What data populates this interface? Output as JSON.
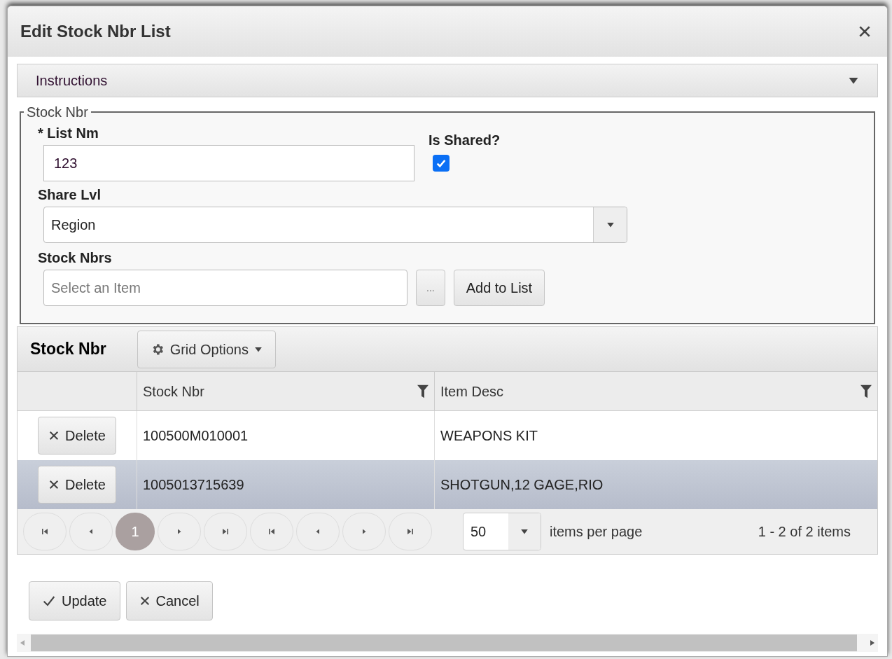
{
  "dialog": {
    "title": "Edit Stock Nbr List"
  },
  "instructions": {
    "label": "Instructions"
  },
  "fieldset": {
    "legend": "Stock Nbr",
    "list_nm": {
      "label": "* List Nm",
      "value": "123"
    },
    "is_shared": {
      "label": "Is Shared?",
      "checked": true
    },
    "share_lvl": {
      "label": "Share Lvl",
      "value": "Region"
    },
    "stock_nbrs": {
      "label": "Stock Nbrs",
      "placeholder": "Select an Item"
    },
    "browse_button": "...",
    "add_button": "Add to List"
  },
  "grid": {
    "title": "Stock Nbr",
    "options_button": "Grid Options",
    "columns": [
      "Stock Nbr",
      "Item Desc"
    ],
    "rows": [
      {
        "action": "Delete",
        "stock_nbr": "100500M010001",
        "item_desc": "WEAPONS KIT",
        "selected": false
      },
      {
        "action": "Delete",
        "stock_nbr": "1005013715639",
        "item_desc": "SHOTGUN,12 GAGE,RIO",
        "selected": true
      }
    ],
    "pager": {
      "buttons": [
        {
          "kind": "first"
        },
        {
          "kind": "prev"
        },
        {
          "kind": "page",
          "label": "1",
          "selected": true
        },
        {
          "kind": "next"
        },
        {
          "kind": "last"
        },
        {
          "kind": "first"
        },
        {
          "kind": "prev"
        },
        {
          "kind": "next"
        },
        {
          "kind": "last"
        }
      ],
      "page_size": "50",
      "page_size_label": "items per page",
      "summary": "1 - 2 of 2 items"
    }
  },
  "buttons": [
    {
      "kind": "update",
      "label": "Update"
    },
    {
      "kind": "cancel",
      "label": "Cancel"
    }
  ]
}
